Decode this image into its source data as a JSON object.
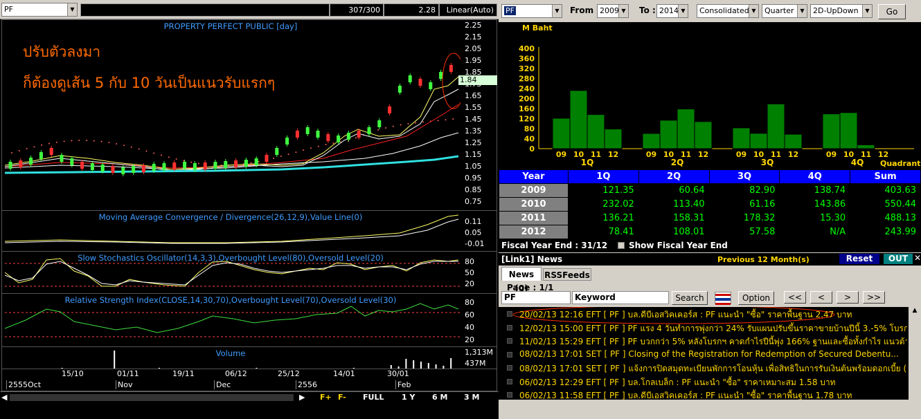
{
  "left": {
    "symbol": "PF",
    "count": "307/300",
    "last": "2.28",
    "scale": "Linear(Auto)",
    "price_title": "PROPERTY PERFECT PUBLIC [day]",
    "annotation_line1": "ปรับตัวลงมา",
    "annotation_line2": "ก็ต้องดูเส้น 5 กับ 10 วันเป็นแนวรับแรกๆ",
    "price_badge": "1.84",
    "price_ticks": [
      "2.25",
      "2.15",
      "2.05",
      "1.95",
      "1.85",
      "1.75",
      "1.65",
      "1.55",
      "1.45",
      "1.35",
      "1.25",
      "1.15",
      "1.05",
      "0.95",
      "0.85",
      "0.75"
    ],
    "macd_title": "Moving Average Convergence / Divergence(26,12,9),Value Line(0)",
    "macd_ticks": [
      "0.11",
      "0.05",
      "-0.01"
    ],
    "stoch_title": "Slow Stochastics Oscillator(14,3,3),Overbought Level(80),Oversold Level(20)",
    "stoch_ticks": [
      "80",
      "50",
      "20"
    ],
    "rsi_title": "Relative Strength Index(CLOSE,14,30,70),Overbought Level(70),Oversold Level(30)",
    "rsi_ticks": [
      "80",
      "60",
      "40",
      "20"
    ],
    "vol_title": "Volume",
    "vol_ticks": [
      "1,313M",
      "437M"
    ],
    "date_ticks": [
      "15/10",
      "01/11",
      "19/11",
      "06/12",
      "25/12",
      "14/01",
      "30/01"
    ],
    "month_ticks": [
      "2555Oct",
      "Nov",
      "Dec",
      "2556",
      "Feb"
    ],
    "bottom": {
      "full": "FULL",
      "y1": "1 Y",
      "m6": "6 M",
      "m3": "3 M",
      "fplus": "F+",
      "fminus": "F-"
    }
  },
  "right": {
    "symbol": "PF",
    "from_label": "From :",
    "from_value": "2009",
    "to_label": "To :",
    "to_value": "2014",
    "consolidated": "Consolidated",
    "period": "Quarter",
    "view": "2D-UpDown",
    "go": "Go",
    "chart_unit": "M Baht",
    "quadrant_label": "Quadrant",
    "chart_data": {
      "type": "bar",
      "ylabel": "M Baht",
      "ylim": [
        0,
        400
      ],
      "yticks": [
        0,
        40,
        80,
        120,
        160,
        200,
        240,
        280,
        320,
        360,
        400
      ],
      "groups": [
        "1Q",
        "2Q",
        "3Q",
        "4Q"
      ],
      "categories": [
        "09",
        "10",
        "11",
        "12"
      ],
      "series": [
        {
          "name": "1Q",
          "values": [
            121.35,
            232.02,
            136.21,
            78.41
          ]
        },
        {
          "name": "2Q",
          "values": [
            60.64,
            113.4,
            158.31,
            108.01
          ]
        },
        {
          "name": "3Q",
          "values": [
            82.9,
            61.16,
            178.32,
            57.58
          ]
        },
        {
          "name": "4Q",
          "values": [
            138.74,
            143.86,
            15.3,
            null
          ]
        }
      ]
    },
    "table": {
      "headers": [
        "Year",
        "1Q",
        "2Q",
        "3Q",
        "4Q",
        "Sum"
      ],
      "rows": [
        [
          "2009",
          "121.35",
          "60.64",
          "82.90",
          "138.74",
          "403.63"
        ],
        [
          "2010",
          "232.02",
          "113.40",
          "61.16",
          "143.86",
          "550.44"
        ],
        [
          "2011",
          "136.21",
          "158.31",
          "178.32",
          "15.30",
          "488.13"
        ],
        [
          "2012",
          "78.41",
          "108.01",
          "57.58",
          "N/A",
          "243.99"
        ]
      ]
    },
    "fiscal_label": "Fiscal  Year  End  :  31/12",
    "show_fiscal": "Show Fiscal Year End",
    "news_header": "[Link1] News",
    "previous": "Previous 12 Month(s)",
    "reset": "Reset",
    "out": "OUT",
    "tab_news": "News (0)",
    "tab_rss": "RSSFeeds",
    "page": "Page : 1/1",
    "news_symbol": "PF",
    "keyword": "Keyword",
    "search": "Search",
    "option": "Option",
    "nav": [
      "<<",
      "<",
      ">",
      ">>"
    ],
    "news": [
      "20/02/13 12:16  EFT  [ PF ]  บล.ดีบีเอสวิคเคอร์ส : PF แนะนำ \"ซื้อ\" ราคาพื้นฐาน 2.47 บาท",
      "12/02/13 15:00  EFT  [ PF ]  PF แรง 4 วันทำการพุ่งกว่า 24% รับแผนปรับขึ้นราคาขายบ้านปีนี้ 3.-5% โบรกฯ แ...",
      "11/02/13 15:29  EFT  [ PF ]  PF บวกกว่า 5% หลังโบรกฯ คาดกำไรปีนี้พุ่ง 166% ฐานและซื้อทั้งกำไร แนวต้าน 1...",
      "08/02/13 17:01  SET  [ PF ]  Closing of the Registration for Redemption of Secured Debentu...",
      "08/02/13 17:01  SET  [ PF ]  แจ้งการปิดสมุดทะเบียนพักการโอนหุ้น เพื่อสิทธิในการรับเงินต้นพร้อมดอกเบี้ย (PF...",
      "06/02/13 12:29  EFT  [ PF ]  บล.โกลเบล็ก : PF แนะนำ \"ซื้อ\" ราคาเหมาะสม 1.58 บาท",
      "06/02/13 11:58  EFT  [ PF ]  บล.ดีบีเอสวิคเคอร์ส : PF แนะนำ \"ซื้อ\" ราคาพื้นฐาน 1.78 บาท"
    ]
  }
}
